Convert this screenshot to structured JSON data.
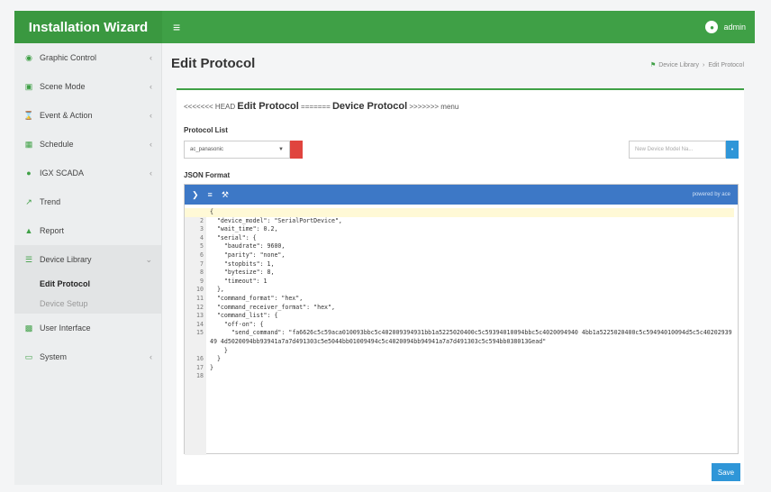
{
  "app": {
    "title": "Installation Wizard",
    "menu_icon": "hamburger-icon",
    "user": "admin",
    "accent": "#3fa046"
  },
  "sidebar": {
    "items": [
      {
        "label": "Graphic Control",
        "icon": "eye-icon"
      },
      {
        "label": "Scene Mode",
        "icon": "image-icon"
      },
      {
        "label": "Event & Action",
        "icon": "hourglass-icon"
      },
      {
        "label": "Schedule",
        "icon": "calendar-icon"
      },
      {
        "label": "IGX SCADA",
        "icon": "globe-icon"
      },
      {
        "label": "Trend",
        "icon": "chart-icon"
      },
      {
        "label": "Report",
        "icon": "report-icon"
      },
      {
        "label": "Device Library",
        "icon": "list-icon"
      },
      {
        "label": "User Interface",
        "icon": "layers-icon"
      },
      {
        "label": "System",
        "icon": "monitor-icon"
      }
    ],
    "sub_items": [
      "Edit Protocol",
      "Device Setup"
    ]
  },
  "page": {
    "title": "Edit Protocol",
    "breadcrumb": [
      "Device Library",
      "Edit Protocol"
    ]
  },
  "content": {
    "heading_prefix": "<<<<<<< HEAD ",
    "heading_main1": "Edit Protocol",
    "heading_mid": " ======= ",
    "heading_main2": "Device Protocol",
    "heading_suffix": " >>>>>>> menu",
    "protocol_list_label": "Protocol List",
    "protocol_selected": "ac_panasonic",
    "model_placeholder": "New Device Model Na...",
    "json_label": "JSON Format",
    "editor_powered": "powered by ace",
    "save_label": "Save"
  },
  "code_lines": [
    {
      "n": "1",
      "t": "{"
    },
    {
      "n": "2",
      "t": "  \"device_model\": \"SerialPortDevice\","
    },
    {
      "n": "3",
      "t": "  \"wait_time\": 0.2,"
    },
    {
      "n": "4",
      "t": "  \"serial\": {"
    },
    {
      "n": "5",
      "t": "    \"baudrate\": 9600,"
    },
    {
      "n": "6",
      "t": "    \"parity\": \"none\","
    },
    {
      "n": "7",
      "t": "    \"stopbits\": 1,"
    },
    {
      "n": "8",
      "t": "    \"bytesize\": 8,"
    },
    {
      "n": "9",
      "t": "    \"timeout\": 1"
    },
    {
      "n": "10",
      "t": "  },"
    },
    {
      "n": "11",
      "t": "  \"command_format\": \"hex\","
    },
    {
      "n": "12",
      "t": "  \"command_receiver_format\": \"hex\","
    },
    {
      "n": "13",
      "t": "  \"command_list\": {"
    },
    {
      "n": "14",
      "t": "    \"off-on\": {"
    },
    {
      "n": "15",
      "t": "      \"send_command\": \"fa6626c5c59aca010093bbc5c402009394931bb1a5225020400c5c59394010094bbc5c4020094940 4bb1a5225020400c5c59494010094d5c5c4020293949 4d5020094bb93941a7a7d491303c5e5044bb01009494c5c4020094bb94941a7a7d491303c5c594bb038013Gead\""
    },
    {
      "n": "16",
      "t": "    }"
    },
    {
      "n": "17",
      "t": "  }"
    },
    {
      "n": "18",
      "t": "}"
    }
  ]
}
